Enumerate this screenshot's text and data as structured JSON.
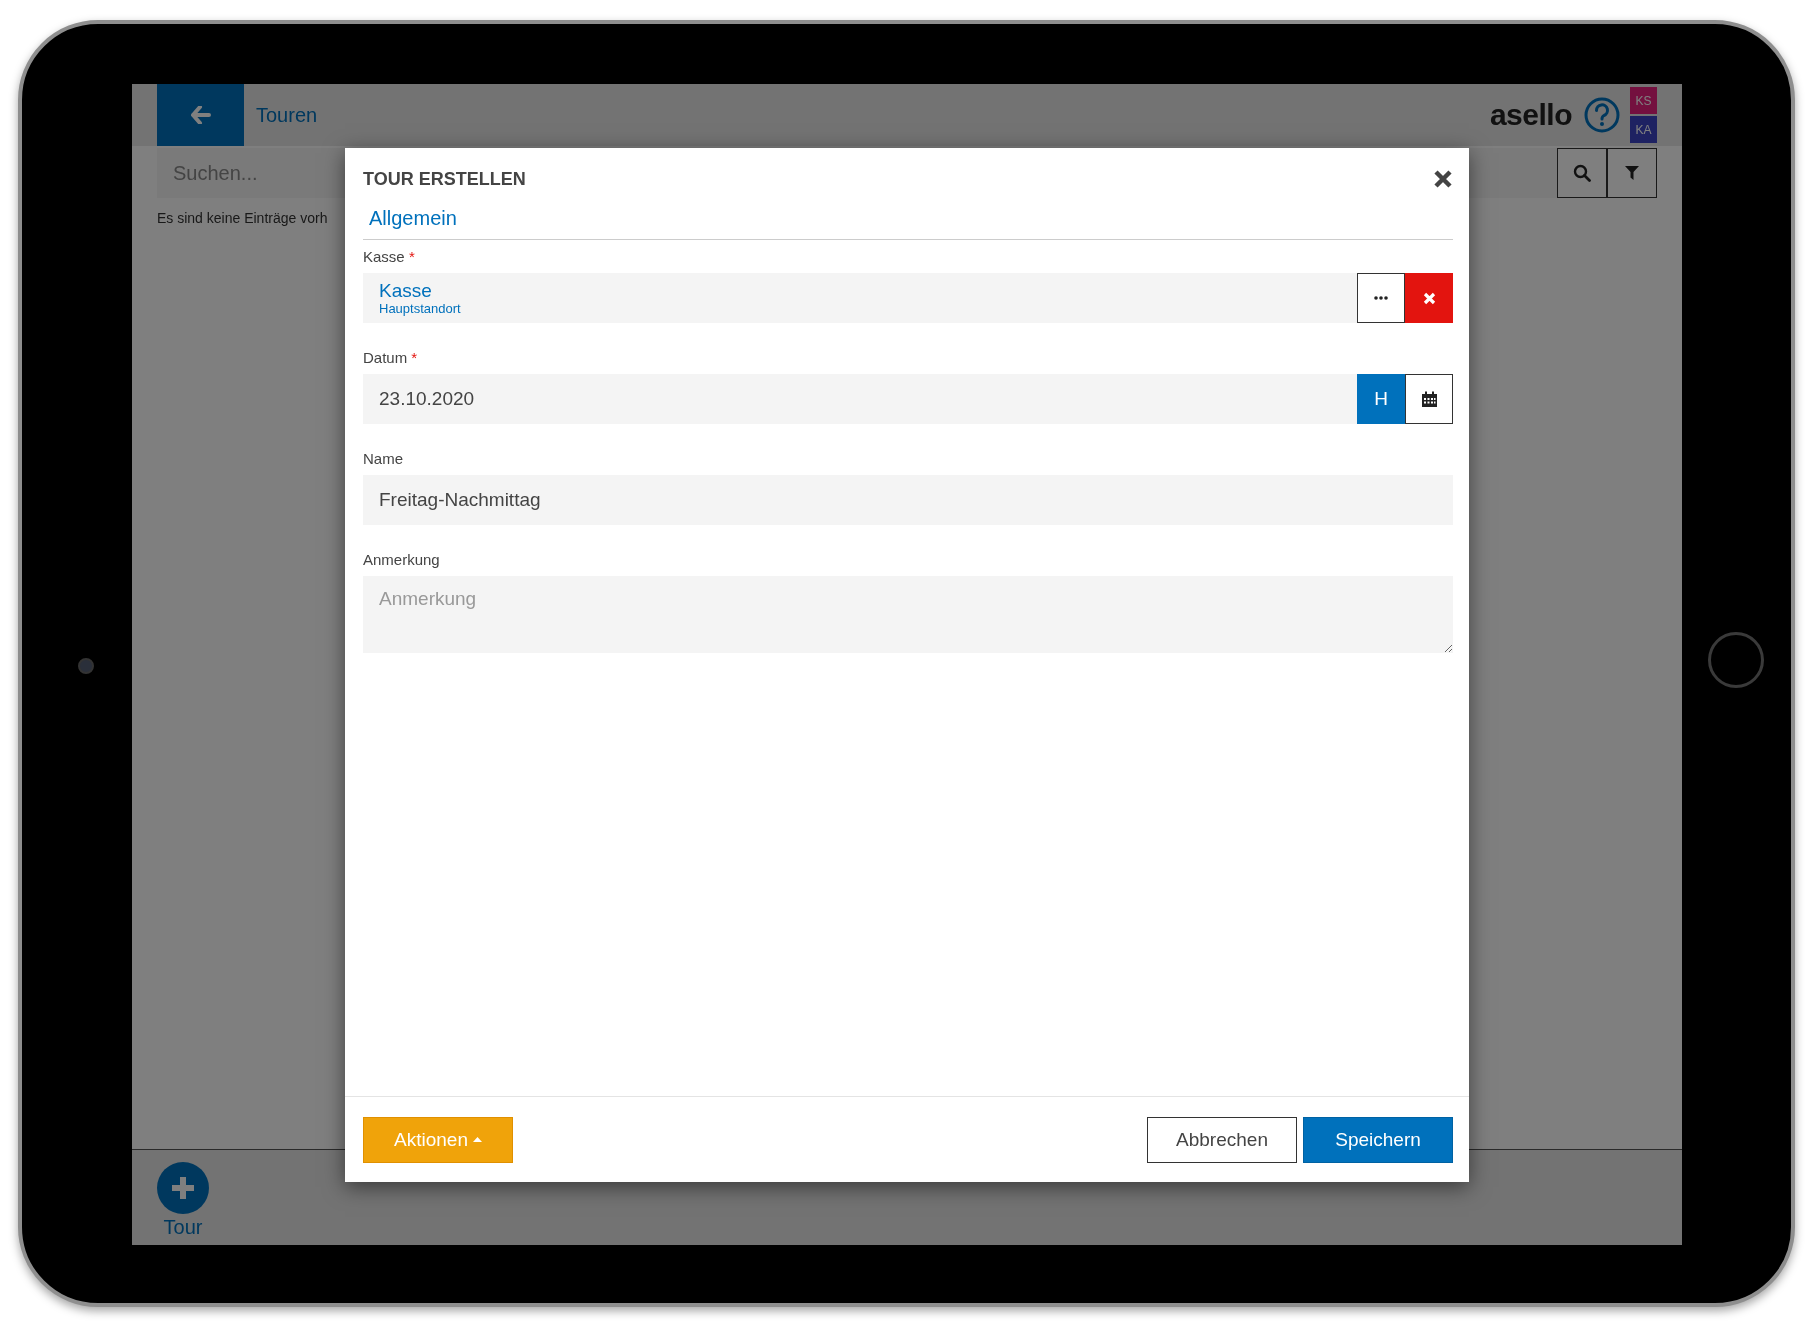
{
  "header": {
    "title": "Touren",
    "logo": "asello",
    "badges": [
      {
        "text": "KS"
      },
      {
        "text": "KA"
      }
    ]
  },
  "search": {
    "placeholder": "Suchen..."
  },
  "empty_message": "Es sind keine Einträge vorh",
  "bottom_bar": {
    "add_label": "Tour"
  },
  "dialog": {
    "title": "TOUR ERSTELLEN",
    "tabs": [
      {
        "label": "Allgemein",
        "selected": true
      }
    ],
    "fields": [
      {
        "kind": "lookup",
        "label": "Kasse",
        "required_mark": "*",
        "value": "Kasse",
        "subvalue": "Hauptstandort"
      },
      {
        "kind": "date",
        "label": "Datum",
        "required_mark": "*",
        "value": "23.10.2020",
        "today_button": "H"
      },
      {
        "kind": "text",
        "label": "Name",
        "value": "Freitag-Nachmittag"
      },
      {
        "kind": "textarea",
        "label": "Anmerkung",
        "placeholder": "Anmerkung"
      }
    ],
    "actions_button": "Aktionen",
    "buttons": [
      {
        "label": "Abbrechen",
        "kind": "secondary"
      },
      {
        "label": "Speichern",
        "kind": "primary"
      }
    ]
  }
}
